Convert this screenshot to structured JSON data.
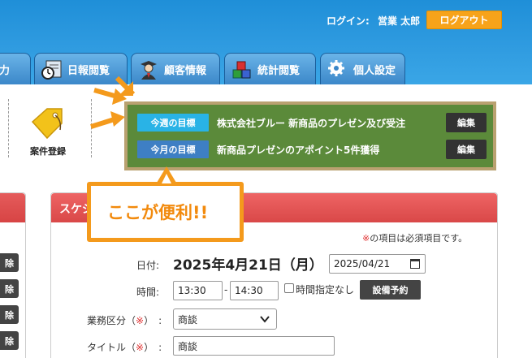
{
  "header": {
    "login_label": "ログイン:",
    "user_name": "営業 太郎",
    "logout_label": "ログアウト"
  },
  "tabs": [
    {
      "label": "力",
      "icon": "partial-tab-icon"
    },
    {
      "label": "日報閲覧",
      "icon": "clock-report-icon"
    },
    {
      "label": "顧客情報",
      "icon": "customer-person-icon"
    },
    {
      "label": "統計閲覧",
      "icon": "cubes-chart-icon"
    },
    {
      "label": "個人設定",
      "icon": "gear-icon"
    }
  ],
  "case_register": {
    "label": "案件登録",
    "icon": "tag-icon"
  },
  "goals": [
    {
      "tag": "今週の目標",
      "text": "株式会社ブルー 新商品のプレゼン及び受注",
      "edit": "編集"
    },
    {
      "tag": "今月の目標",
      "text": "新商品プレゼンのアポイント5件獲得",
      "edit": "編集"
    }
  ],
  "callout": {
    "text": "ここが便利!!"
  },
  "left_panel": {
    "delete_buttons": [
      "除",
      "除",
      "除",
      "除"
    ]
  },
  "form": {
    "panel_title": "スケジ",
    "required_mark": "※",
    "required_note": "の項目は必須項目です。",
    "date_label": "日付:",
    "date_display": "2025年4月21日（月）",
    "date_value": "2025/04/21",
    "time_label": "時間:",
    "time_start": "13:30",
    "time_separator": "-",
    "time_end": "14:30",
    "no_time_label": "時間指定なし",
    "facility_button": "設備予約",
    "category_label": "業務区分",
    "category_value": "商談",
    "title_label": "タイトル",
    "title_value": "商談",
    "req_open": "（",
    "req_close": "）",
    "colon": ":"
  },
  "colors": {
    "header_blue": "#2f9be0",
    "logout_orange": "#f7a31a",
    "goal_panel_green": "#5b8a3a",
    "goal_panel_border": "#b9a170",
    "week_tag": "#29b3e6",
    "month_tag": "#3e7fc4",
    "panel_red": "#d94848",
    "callout_orange": "#f49a1c"
  }
}
